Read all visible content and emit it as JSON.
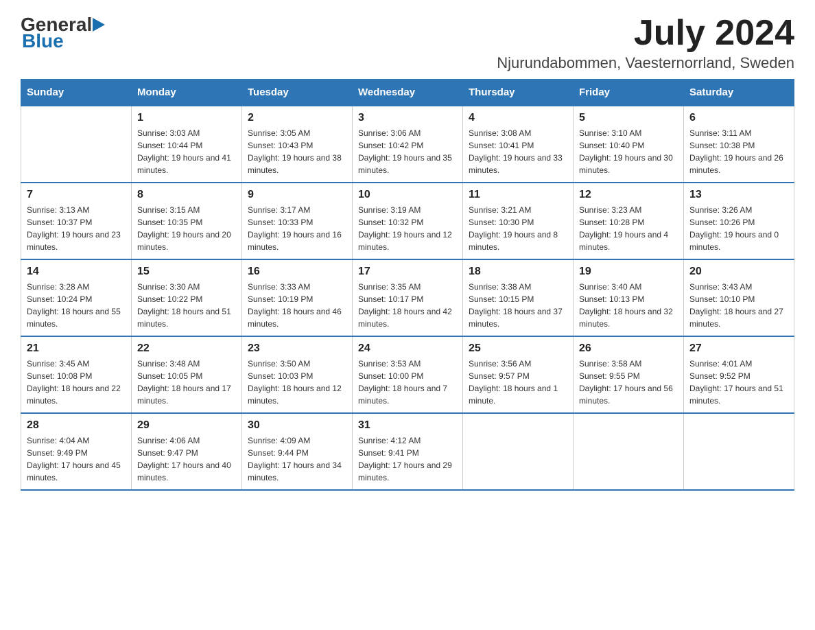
{
  "header": {
    "logo": {
      "general": "General",
      "blue": "Blue"
    },
    "title": "July 2024",
    "location": "Njurundabommen, Vaesternorrland, Sweden"
  },
  "calendar": {
    "days_of_week": [
      "Sunday",
      "Monday",
      "Tuesday",
      "Wednesday",
      "Thursday",
      "Friday",
      "Saturday"
    ],
    "weeks": [
      [
        {
          "day": "",
          "sunrise": "",
          "sunset": "",
          "daylight": ""
        },
        {
          "day": "1",
          "sunrise": "Sunrise: 3:03 AM",
          "sunset": "Sunset: 10:44 PM",
          "daylight": "Daylight: 19 hours and 41 minutes."
        },
        {
          "day": "2",
          "sunrise": "Sunrise: 3:05 AM",
          "sunset": "Sunset: 10:43 PM",
          "daylight": "Daylight: 19 hours and 38 minutes."
        },
        {
          "day": "3",
          "sunrise": "Sunrise: 3:06 AM",
          "sunset": "Sunset: 10:42 PM",
          "daylight": "Daylight: 19 hours and 35 minutes."
        },
        {
          "day": "4",
          "sunrise": "Sunrise: 3:08 AM",
          "sunset": "Sunset: 10:41 PM",
          "daylight": "Daylight: 19 hours and 33 minutes."
        },
        {
          "day": "5",
          "sunrise": "Sunrise: 3:10 AM",
          "sunset": "Sunset: 10:40 PM",
          "daylight": "Daylight: 19 hours and 30 minutes."
        },
        {
          "day": "6",
          "sunrise": "Sunrise: 3:11 AM",
          "sunset": "Sunset: 10:38 PM",
          "daylight": "Daylight: 19 hours and 26 minutes."
        }
      ],
      [
        {
          "day": "7",
          "sunrise": "Sunrise: 3:13 AM",
          "sunset": "Sunset: 10:37 PM",
          "daylight": "Daylight: 19 hours and 23 minutes."
        },
        {
          "day": "8",
          "sunrise": "Sunrise: 3:15 AM",
          "sunset": "Sunset: 10:35 PM",
          "daylight": "Daylight: 19 hours and 20 minutes."
        },
        {
          "day": "9",
          "sunrise": "Sunrise: 3:17 AM",
          "sunset": "Sunset: 10:33 PM",
          "daylight": "Daylight: 19 hours and 16 minutes."
        },
        {
          "day": "10",
          "sunrise": "Sunrise: 3:19 AM",
          "sunset": "Sunset: 10:32 PM",
          "daylight": "Daylight: 19 hours and 12 minutes."
        },
        {
          "day": "11",
          "sunrise": "Sunrise: 3:21 AM",
          "sunset": "Sunset: 10:30 PM",
          "daylight": "Daylight: 19 hours and 8 minutes."
        },
        {
          "day": "12",
          "sunrise": "Sunrise: 3:23 AM",
          "sunset": "Sunset: 10:28 PM",
          "daylight": "Daylight: 19 hours and 4 minutes."
        },
        {
          "day": "13",
          "sunrise": "Sunrise: 3:26 AM",
          "sunset": "Sunset: 10:26 PM",
          "daylight": "Daylight: 19 hours and 0 minutes."
        }
      ],
      [
        {
          "day": "14",
          "sunrise": "Sunrise: 3:28 AM",
          "sunset": "Sunset: 10:24 PM",
          "daylight": "Daylight: 18 hours and 55 minutes."
        },
        {
          "day": "15",
          "sunrise": "Sunrise: 3:30 AM",
          "sunset": "Sunset: 10:22 PM",
          "daylight": "Daylight: 18 hours and 51 minutes."
        },
        {
          "day": "16",
          "sunrise": "Sunrise: 3:33 AM",
          "sunset": "Sunset: 10:19 PM",
          "daylight": "Daylight: 18 hours and 46 minutes."
        },
        {
          "day": "17",
          "sunrise": "Sunrise: 3:35 AM",
          "sunset": "Sunset: 10:17 PM",
          "daylight": "Daylight: 18 hours and 42 minutes."
        },
        {
          "day": "18",
          "sunrise": "Sunrise: 3:38 AM",
          "sunset": "Sunset: 10:15 PM",
          "daylight": "Daylight: 18 hours and 37 minutes."
        },
        {
          "day": "19",
          "sunrise": "Sunrise: 3:40 AM",
          "sunset": "Sunset: 10:13 PM",
          "daylight": "Daylight: 18 hours and 32 minutes."
        },
        {
          "day": "20",
          "sunrise": "Sunrise: 3:43 AM",
          "sunset": "Sunset: 10:10 PM",
          "daylight": "Daylight: 18 hours and 27 minutes."
        }
      ],
      [
        {
          "day": "21",
          "sunrise": "Sunrise: 3:45 AM",
          "sunset": "Sunset: 10:08 PM",
          "daylight": "Daylight: 18 hours and 22 minutes."
        },
        {
          "day": "22",
          "sunrise": "Sunrise: 3:48 AM",
          "sunset": "Sunset: 10:05 PM",
          "daylight": "Daylight: 18 hours and 17 minutes."
        },
        {
          "day": "23",
          "sunrise": "Sunrise: 3:50 AM",
          "sunset": "Sunset: 10:03 PM",
          "daylight": "Daylight: 18 hours and 12 minutes."
        },
        {
          "day": "24",
          "sunrise": "Sunrise: 3:53 AM",
          "sunset": "Sunset: 10:00 PM",
          "daylight": "Daylight: 18 hours and 7 minutes."
        },
        {
          "day": "25",
          "sunrise": "Sunrise: 3:56 AM",
          "sunset": "Sunset: 9:57 PM",
          "daylight": "Daylight: 18 hours and 1 minute."
        },
        {
          "day": "26",
          "sunrise": "Sunrise: 3:58 AM",
          "sunset": "Sunset: 9:55 PM",
          "daylight": "Daylight: 17 hours and 56 minutes."
        },
        {
          "day": "27",
          "sunrise": "Sunrise: 4:01 AM",
          "sunset": "Sunset: 9:52 PM",
          "daylight": "Daylight: 17 hours and 51 minutes."
        }
      ],
      [
        {
          "day": "28",
          "sunrise": "Sunrise: 4:04 AM",
          "sunset": "Sunset: 9:49 PM",
          "daylight": "Daylight: 17 hours and 45 minutes."
        },
        {
          "day": "29",
          "sunrise": "Sunrise: 4:06 AM",
          "sunset": "Sunset: 9:47 PM",
          "daylight": "Daylight: 17 hours and 40 minutes."
        },
        {
          "day": "30",
          "sunrise": "Sunrise: 4:09 AM",
          "sunset": "Sunset: 9:44 PM",
          "daylight": "Daylight: 17 hours and 34 minutes."
        },
        {
          "day": "31",
          "sunrise": "Sunrise: 4:12 AM",
          "sunset": "Sunset: 9:41 PM",
          "daylight": "Daylight: 17 hours and 29 minutes."
        },
        {
          "day": "",
          "sunrise": "",
          "sunset": "",
          "daylight": ""
        },
        {
          "day": "",
          "sunrise": "",
          "sunset": "",
          "daylight": ""
        },
        {
          "day": "",
          "sunrise": "",
          "sunset": "",
          "daylight": ""
        }
      ]
    ]
  }
}
